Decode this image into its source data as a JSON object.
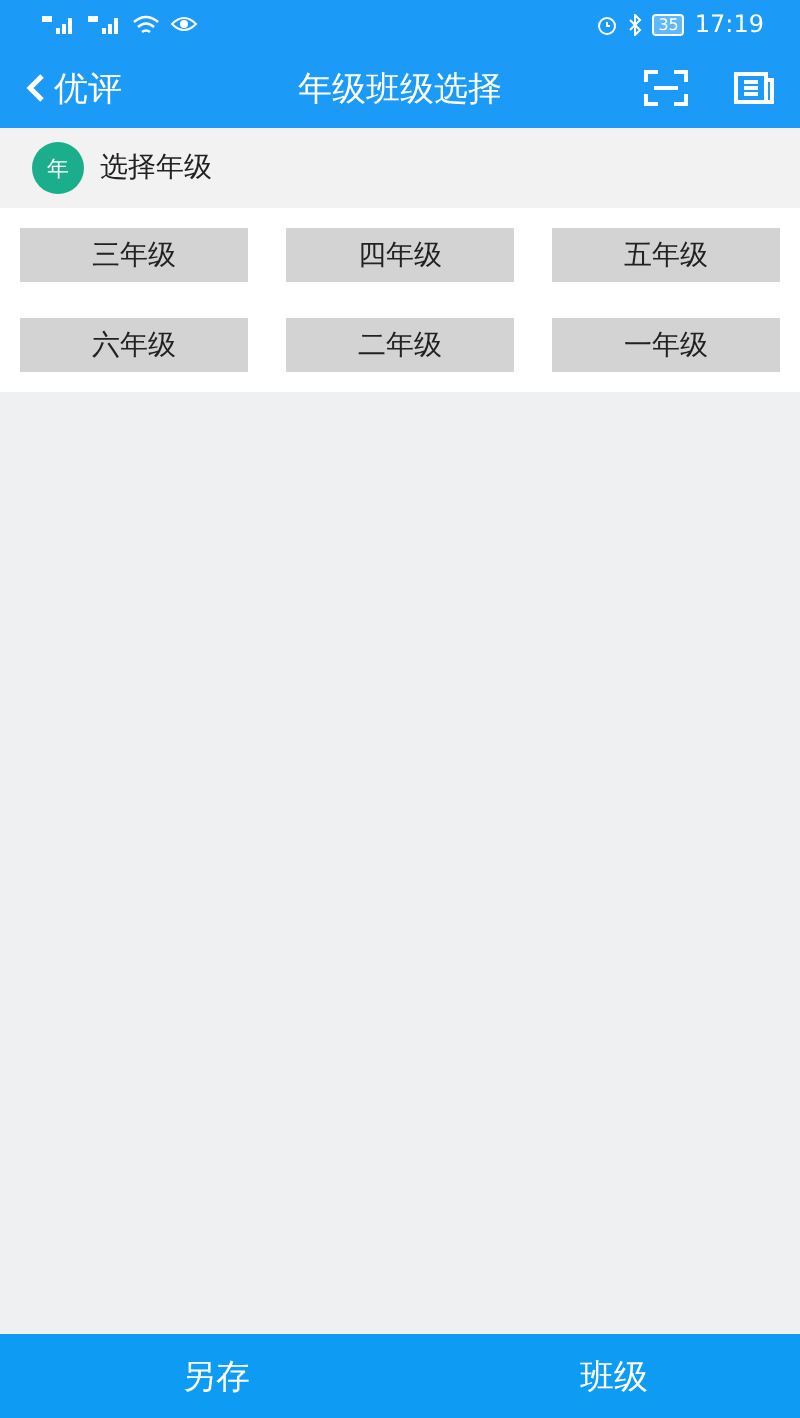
{
  "status_bar": {
    "battery": "35",
    "time": "17:19"
  },
  "header": {
    "back_label": "优评",
    "title": "年级班级选择"
  },
  "section": {
    "badge": "年",
    "title": "选择年级"
  },
  "grades": [
    {
      "label": "三年级"
    },
    {
      "label": "四年级"
    },
    {
      "label": "五年级"
    },
    {
      "label": "六年级"
    },
    {
      "label": "二年级"
    },
    {
      "label": "一年级"
    }
  ],
  "bottom_bar": {
    "buttons": [
      "另存",
      "班级"
    ]
  }
}
